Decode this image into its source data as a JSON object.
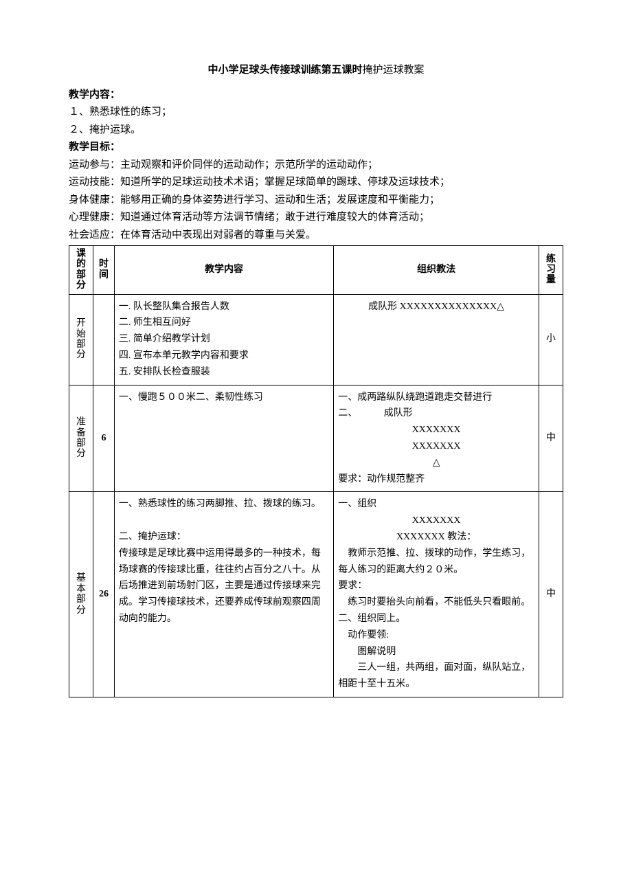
{
  "title_bold": "中小学足球头传接球训练第五课时",
  "title_plain": "掩护运球教案",
  "section_content_label": "教学内容：",
  "content_items": [
    "１、熟悉球性的练习；",
    "２、掩护运球。"
  ],
  "section_goal_label": "教学目标：",
  "goal_items": [
    "运动参与：主动观察和评价同伴的运动动作；示范所学的运动动作；",
    "运动技能：知道所学的足球运动技术术语；掌握足球简单的踢球、停球及运球技术；",
    "身体健康：能够用正确的身体姿势进行学习、运动和生活；发展速度和平衡能力；",
    "心理健康：知道通过体育活动等方法调节情绪；敢于进行难度较大的体育活动；",
    "社会适应：在体育活动中表现出对弱者的尊重与关爱。"
  ],
  "headers": {
    "part": "课的部分",
    "time": "时间",
    "content": "教学内容",
    "method": "组织教法",
    "load": "练习量"
  },
  "rows": {
    "start": {
      "part": "开始部分",
      "time": "",
      "content": "一. 队长整队集合报告人数\n二. 师生相互问好\n三. 简单介绍教学计划\n四. 宣布本单元教学内容和要求\n五. 安排队长检查服装",
      "method": "成队形 XXXXXXXXXXXXXX△",
      "load": "小"
    },
    "prep": {
      "part": "准备部分",
      "time": "6",
      "content": "一、慢跑５００米二、柔韧性练习",
      "method_l1": "一、成两路纵队绕跑道跑走交替进行",
      "method_l2": "二、           成队形",
      "method_l3": "XXXXXXX",
      "method_l4": "XXXXXXX",
      "method_l5": "△",
      "method_l6": "要求：动作规范整齐",
      "load": "中"
    },
    "main": {
      "part": "基本部分",
      "time": "26",
      "content": "一、熟悉球性的练习两脚推、拉、拨球的练习。\n\n二、掩护运球：\n传接球是足球比赛中运用得最多的一种技术，每场球赛的传接球比重，往往约占百分之八十。从后场推进到前场射门区，主要是通过传接球来完成。学习传接球技术，还要养成传球前观察四周动向的能力。",
      "method_l1": "一、组织",
      "method_l2": "XXXXXXX",
      "method_l3": "XXXXXXX 教法：",
      "method_l4": "　教师示范推、拉、拨球的动作，学生练习，每人练习的距离大约２０米。",
      "method_l5": "要求：",
      "method_l6": "　练习时要抬头向前看，不能低头只看眼前。",
      "method_l7": "二、组织同上。",
      "method_l8": "　动作要领:",
      "method_l9": "　　图解说明",
      "method_l10": "　　三人一组，共两组，面对面，纵队站立，相距十至十五米。",
      "load": "中"
    }
  }
}
